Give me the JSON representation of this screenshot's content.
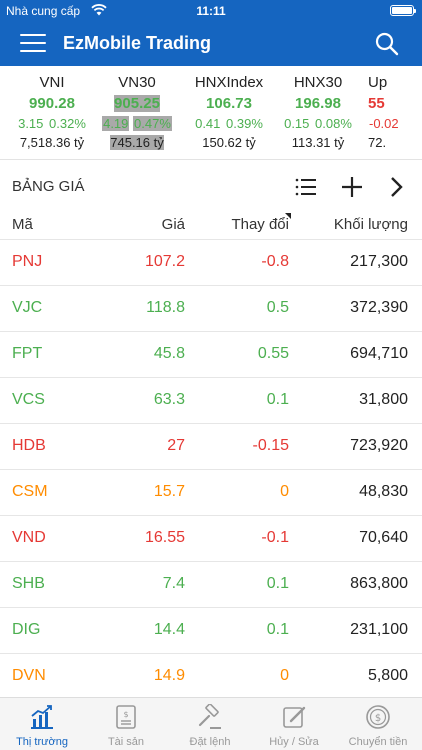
{
  "status_bar": {
    "carrier": "Nhà cung cấp",
    "time": "11:11"
  },
  "header": {
    "title": "EzMobile Trading",
    "menu_icon": "hamburger-icon",
    "search_icon": "search-icon"
  },
  "colors": {
    "brand": "#1565c0",
    "up": "#4caf50",
    "down": "#e53935",
    "neutral": "#ff8c00"
  },
  "indices": [
    {
      "name": "VNI",
      "value": "990.28",
      "change": "3.15",
      "percent": "0.32%",
      "volume": "7,518.36 tỷ",
      "direction": "up"
    },
    {
      "name": "VN30",
      "value": "905.25",
      "change": "4.19",
      "percent": "0.47%",
      "volume": "745.16 tỷ",
      "direction": "up"
    },
    {
      "name": "HNXIndex",
      "value": "106.73",
      "change": "0.41",
      "percent": "0.39%",
      "volume": "150.62 tỷ",
      "direction": "up"
    },
    {
      "name": "HNX30",
      "value": "196.98",
      "change": "0.15",
      "percent": "0.08%",
      "volume": "113.31 tỷ",
      "direction": "up"
    },
    {
      "name": "Up",
      "value": "55",
      "change": "-0.02",
      "percent": "",
      "volume": "72.",
      "direction": "down"
    }
  ],
  "board": {
    "title": "BẢNG GIÁ",
    "columns": {
      "symbol": "Mã",
      "price": "Giá",
      "change": "Thay đổi",
      "volume": "Khối lượng"
    },
    "rows": [
      {
        "symbol": "PNJ",
        "price": "107.2",
        "change": "-0.8",
        "volume": "217,300",
        "direction": "down"
      },
      {
        "symbol": "VJC",
        "price": "118.8",
        "change": "0.5",
        "volume": "372,390",
        "direction": "up"
      },
      {
        "symbol": "FPT",
        "price": "45.8",
        "change": "0.55",
        "volume": "694,710",
        "direction": "up"
      },
      {
        "symbol": "VCS",
        "price": "63.3",
        "change": "0.1",
        "volume": "31,800",
        "direction": "up"
      },
      {
        "symbol": "HDB",
        "price": "27",
        "change": "-0.15",
        "volume": "723,920",
        "direction": "down"
      },
      {
        "symbol": "CSM",
        "price": "15.7",
        "change": "0",
        "volume": "48,830",
        "direction": "neutral"
      },
      {
        "symbol": "VND",
        "price": "16.55",
        "change": "-0.1",
        "volume": "70,640",
        "direction": "down"
      },
      {
        "symbol": "SHB",
        "price": "7.4",
        "change": "0.1",
        "volume": "863,800",
        "direction": "up"
      },
      {
        "symbol": "DIG",
        "price": "14.4",
        "change": "0.1",
        "volume": "231,100",
        "direction": "up"
      },
      {
        "symbol": "DVN",
        "price": "14.9",
        "change": "0",
        "volume": "5,800",
        "direction": "neutral"
      }
    ]
  },
  "tabs": [
    {
      "label": "Thị trường",
      "icon": "market-chart-icon",
      "active": true
    },
    {
      "label": "Tài sản",
      "icon": "assets-document-icon",
      "active": false
    },
    {
      "label": "Đặt lệnh",
      "icon": "gavel-order-icon",
      "active": false
    },
    {
      "label": "Hủy / Sửa",
      "icon": "edit-pencil-icon",
      "active": false
    },
    {
      "label": "Chuyển tiền",
      "icon": "money-transfer-icon",
      "active": false
    }
  ]
}
